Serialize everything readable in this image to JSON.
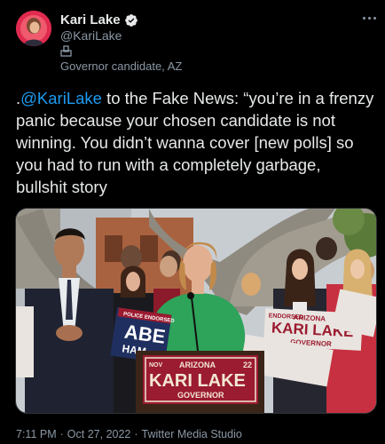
{
  "author": {
    "display_name": "Kari Lake",
    "handle": "@KariLake",
    "affiliation": "Governor candidate, AZ",
    "verified": true
  },
  "tweet": {
    "prefix": ".",
    "mention": "@KariLake",
    "body": " to the Fake News: “you’re in a frenzy panic because your chosen candidate is not winning. You didn’t wanna cover [new polls] so you had to run with a completely garbage, bullshit story"
  },
  "media": {
    "podium_sign": {
      "top_left": "NOV",
      "state": "ARIZONA",
      "top_right": "22",
      "name": "KARI LAKE",
      "office": "GOVERNOR"
    },
    "left_sign": {
      "banner": "POLICE ENDORSED",
      "line1": "ABE",
      "line2": "HAM"
    },
    "right_sign": {
      "banner": "ENDORSED",
      "state": "ARIZONA",
      "name": "KARI LAKE",
      "office": "GOVERNOR"
    }
  },
  "meta": {
    "time": "7:11 PM",
    "separator1": "·",
    "date": "Oct 27, 2022",
    "separator2": "·",
    "source": "Twitter Media Studio"
  },
  "colors": {
    "background": "#000000",
    "text": "#e7e9ea",
    "secondary": "#8b98a5",
    "link": "#1d9bf0",
    "sign_red": "#9b1b30",
    "sign_blue": "#1f2f5f"
  }
}
